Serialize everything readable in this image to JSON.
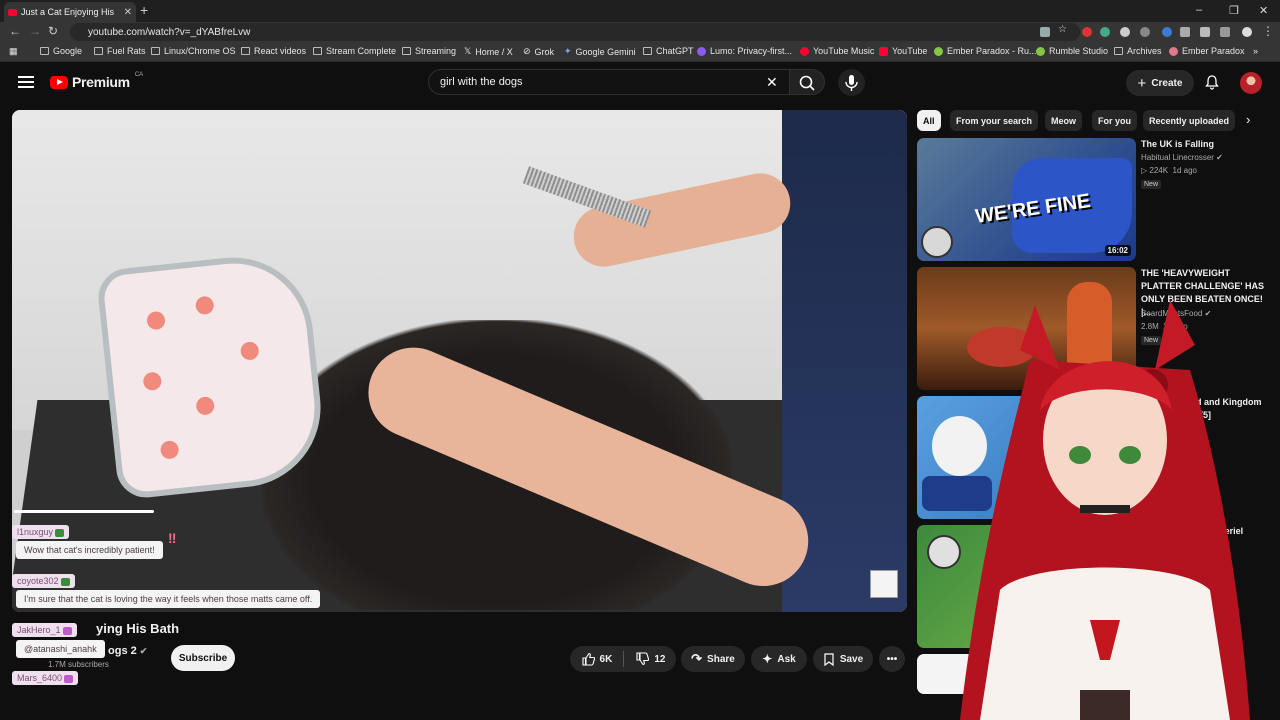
{
  "browser": {
    "tab_title": "Just a Cat Enjoying His",
    "new_tab": "+",
    "url": "youtube.com/watch?v=_dYABfreLvw",
    "window_controls": [
      "–",
      "❐",
      "✕"
    ]
  },
  "bookmarks": [
    {
      "label": "Google"
    },
    {
      "label": "Fuel Rats"
    },
    {
      "label": "Linux/Chrome OS"
    },
    {
      "label": "React videos"
    },
    {
      "label": "Stream Complete"
    },
    {
      "label": "Streaming"
    },
    {
      "label": "Home / X"
    },
    {
      "label": "Grok"
    },
    {
      "label": "Google Gemini"
    },
    {
      "label": "ChatGPT"
    },
    {
      "label": "Lumo: Privacy-first..."
    },
    {
      "label": "YouTube Music"
    },
    {
      "label": "YouTube"
    },
    {
      "label": "Ember Paradox - Ru..."
    },
    {
      "label": "Rumble Studio"
    },
    {
      "label": "Archives"
    },
    {
      "label": "Ember Paradox"
    }
  ],
  "header": {
    "logo_text": "Premium",
    "logo_region": "CA",
    "search_value": "girl with the dogs",
    "create_label": "Create"
  },
  "video": {
    "title_visible": "ying His Bath",
    "channel_visible": "ogs 2",
    "subs": "1.7M subscribers",
    "subscribe_label": "Subscribe",
    "likes": "6K",
    "dislikes": "12",
    "share_label": "Share",
    "ask_label": "Ask",
    "save_label": "Save"
  },
  "chat": [
    {
      "user": "l1nuxguy",
      "message": "Wow that cat's incredibly patient!"
    },
    {
      "user": "coyote302",
      "message": "I'm sure that the cat is loving the way it feels when those matts came off."
    },
    {
      "user": "JakHero_1",
      "message": "@atanashi_anahk"
    },
    {
      "user": "Mars_6400",
      "message": ""
    }
  ],
  "chips": [
    "All",
    "From your search",
    "Meow",
    "For you",
    "Recently uploaded"
  ],
  "recommendations": [
    {
      "title": "The UK is Falling",
      "channel": "Habitual Linecrosser",
      "views": "▷ 224K",
      "age": "1d ago",
      "badge": "New",
      "duration": "16:02",
      "thumb_text": "WE'RE FINE"
    },
    {
      "title": "THE 'HEAVYWEIGHT PLATTER CHALLENGE' HAS ONLY BEEN BEATEN ONCE! |...",
      "channel": "BeardMeatsFood",
      "views": "2.8M",
      "age": "2d ago",
      "badge": "New"
    },
    {
      "title": "This is cursed and Kingdom hearts 1 ugh! [5]",
      "channel": "",
      "views": "",
      "age": ""
    },
    {
      "title": "ress (The ) Anti-Materiel",
      "channel": "",
      "views": "",
      "age": ""
    }
  ],
  "colors": {
    "brand_red": "#ff0000",
    "chat_user_bg": "#f0e0ee",
    "background": "#0f0f0f"
  }
}
